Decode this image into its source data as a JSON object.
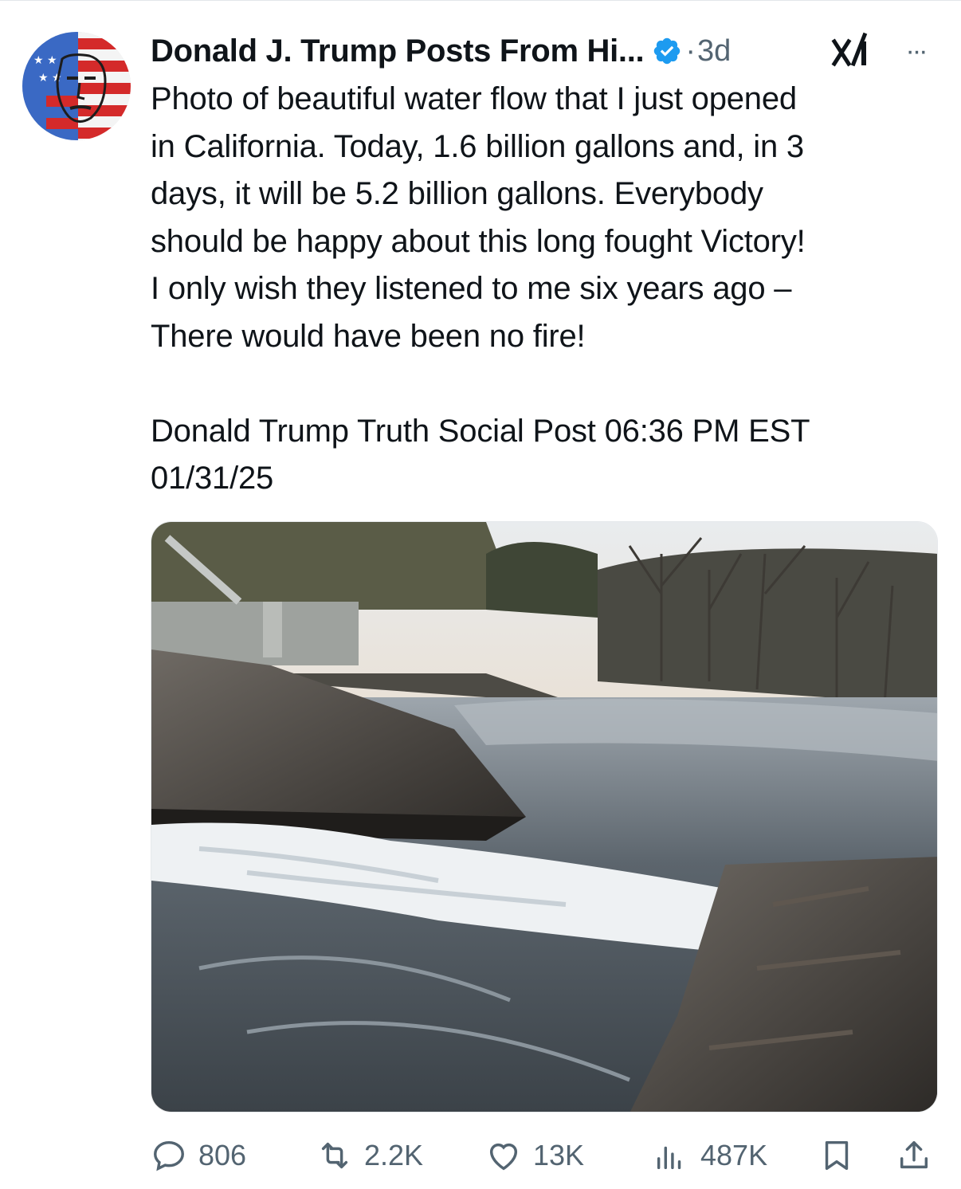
{
  "post": {
    "author_name": "Donald J. Trump Posts From Hi...",
    "separator": "·",
    "time": "3d",
    "text_lines": [
      "Photo of beautiful water flow that I just opened",
      "in California. Today, 1.6 billion gallons and, in 3",
      "days, it will be 5.2 billion gallons. Everybody",
      "should be happy about this long fought Victory!",
      "I only wish they listened to me six years ago –",
      "There would have been no fire!"
    ],
    "source_lines": [
      "Donald Trump Truth Social Post 06:36 PM EST",
      "01/31/25"
    ],
    "image_content": "river water flowing over rocks next to a concrete dam structure at sunset"
  },
  "actions": {
    "replies": "806",
    "reposts": "2.2K",
    "likes": "13K",
    "views": "487K"
  },
  "icons": {
    "verified": "verified-badge-icon",
    "grok": "xai-grok-icon",
    "more": "more-icon",
    "reply": "reply-icon",
    "repost": "repost-icon",
    "like": "heart-icon",
    "views": "views-icon",
    "bookmark": "bookmark-icon",
    "share": "share-icon"
  },
  "colors": {
    "text": "#0f1419",
    "secondary": "#536471",
    "verified": "#1d9bf0"
  }
}
